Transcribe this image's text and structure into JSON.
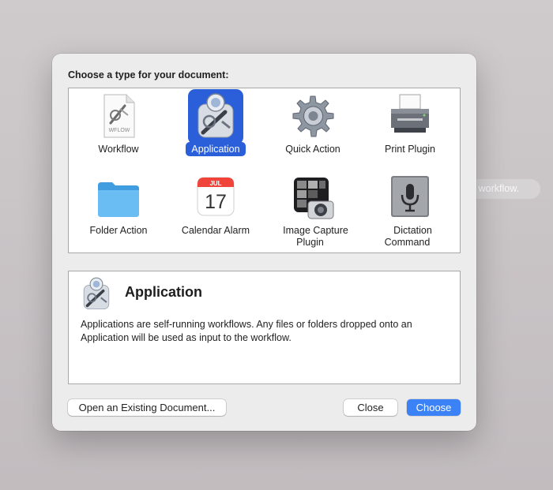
{
  "background": {
    "hint_text": "r workflow."
  },
  "dialog": {
    "heading": "Choose a type for your document:",
    "types": [
      {
        "label": "Workflow",
        "icon": "workflow-document-icon",
        "doc_tag": "WFLOW",
        "selected": false
      },
      {
        "label": "Application",
        "icon": "automator-robot-icon",
        "selected": true
      },
      {
        "label": "Quick Action",
        "icon": "gear-icon",
        "selected": false
      },
      {
        "label": "Print Plugin",
        "icon": "printer-icon",
        "selected": false
      },
      {
        "label": "Folder Action",
        "icon": "folder-icon",
        "selected": false
      },
      {
        "label": "Calendar Alarm",
        "icon": "calendar-icon",
        "calendar_month": "JUL",
        "calendar_day": "17",
        "selected": false
      },
      {
        "label": "Image Capture\nPlugin",
        "icon": "image-capture-icon",
        "selected": false
      },
      {
        "label": "Dictation\nCommand",
        "icon": "microphone-icon",
        "selected": false
      }
    ],
    "description": {
      "title": "Application",
      "text": "Applications are self-running workflows. Any files or folders dropped onto an Application will be used as input to the workflow."
    },
    "buttons": {
      "open_existing": "Open an Existing Document...",
      "close": "Close",
      "choose": "Choose"
    }
  },
  "colors": {
    "selection": "#2b5fd9",
    "primary_button": "#3a82f6"
  }
}
